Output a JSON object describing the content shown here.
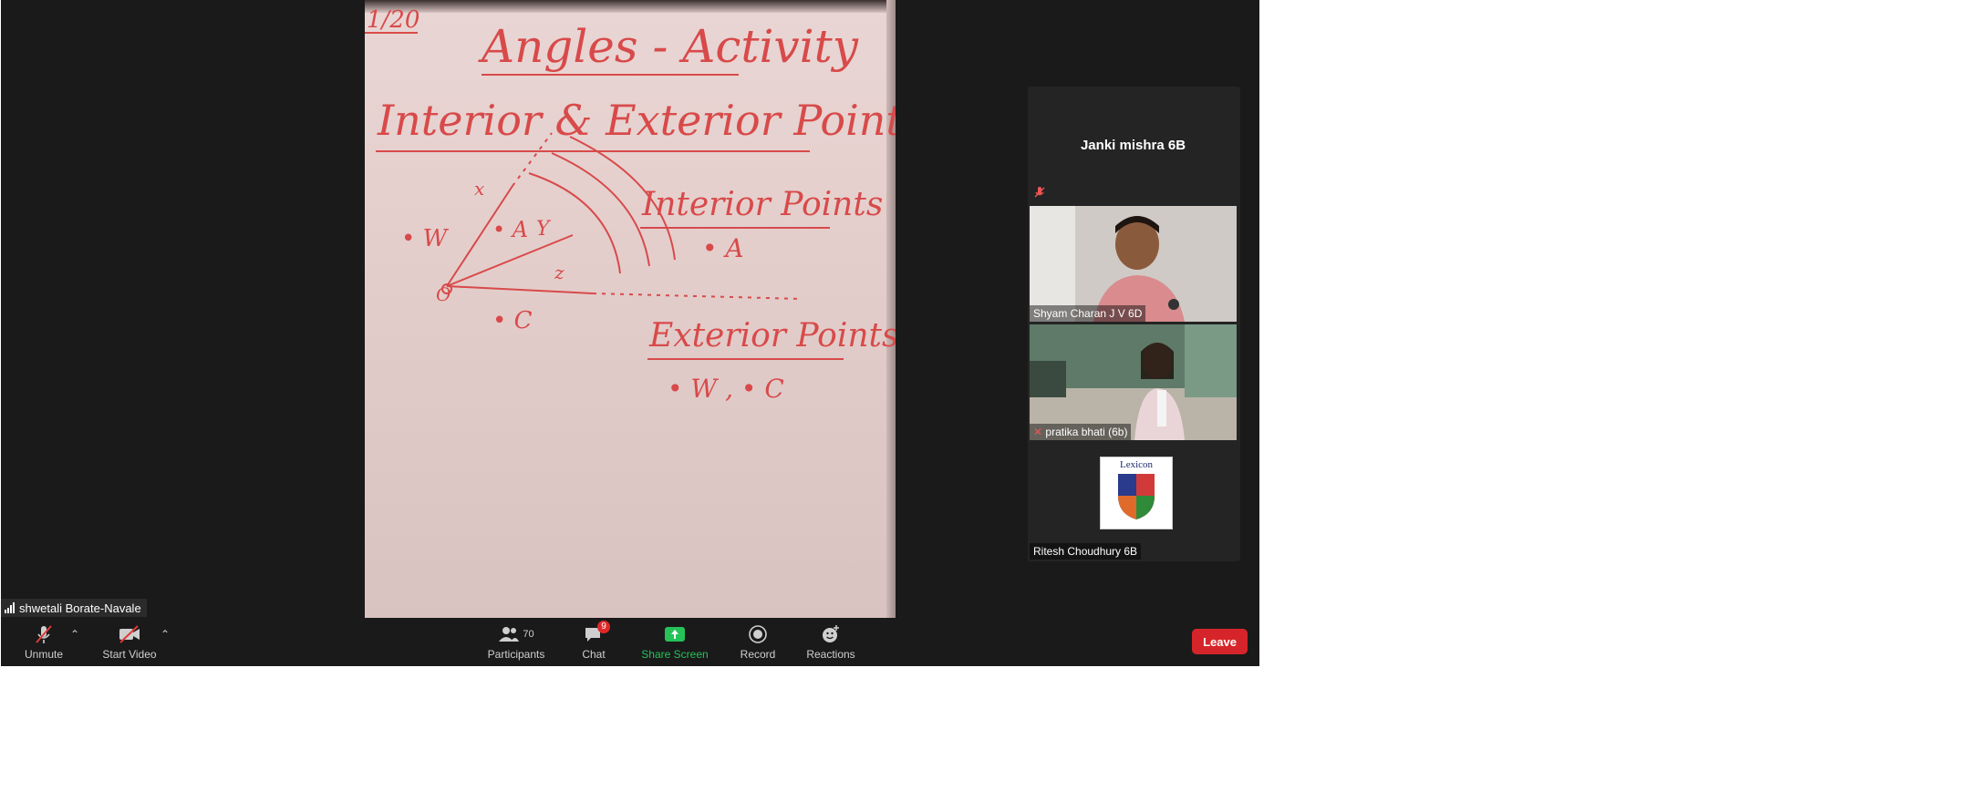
{
  "meeting": {
    "presenter_name": "shwetali Borate-Navale"
  },
  "whiteboard": {
    "date": "1/20",
    "title": "Angles - Activity",
    "subtitle": "Interior & Exterior Points",
    "interior_heading": "Interior Points :-",
    "interior_points": "• A",
    "exterior_heading": "Exterior Points :-",
    "exterior_points": "• W ,  • C",
    "diagram_labels": {
      "o": "O",
      "w": "• W",
      "a": "• A",
      "y": "Y",
      "x": "x",
      "z": "z",
      "c": "• C"
    }
  },
  "gallery": {
    "tiles": [
      {
        "name": "Janki mishra 6B"
      },
      {
        "name": "Shyam Charan J V 6D"
      },
      {
        "name": "pratika bhati (6b)"
      },
      {
        "name": "Ritesh Choudhury 6B"
      }
    ],
    "ritesh_logo": {
      "title": "Lexicon"
    }
  },
  "toolbar": {
    "unmute_label": "Unmute",
    "start_video_label": "Start Video",
    "participants_label": "Participants",
    "participants_count": "70",
    "chat_label": "Chat",
    "chat_badge": "9",
    "share_screen_label": "Share Screen",
    "record_label": "Record",
    "reactions_label": "Reactions",
    "leave_label": "Leave"
  },
  "colors": {
    "background": "#1a1a1a",
    "share_green": "#25c25a",
    "leave_red": "#d6252a",
    "ink_red": "#d84a4a"
  }
}
